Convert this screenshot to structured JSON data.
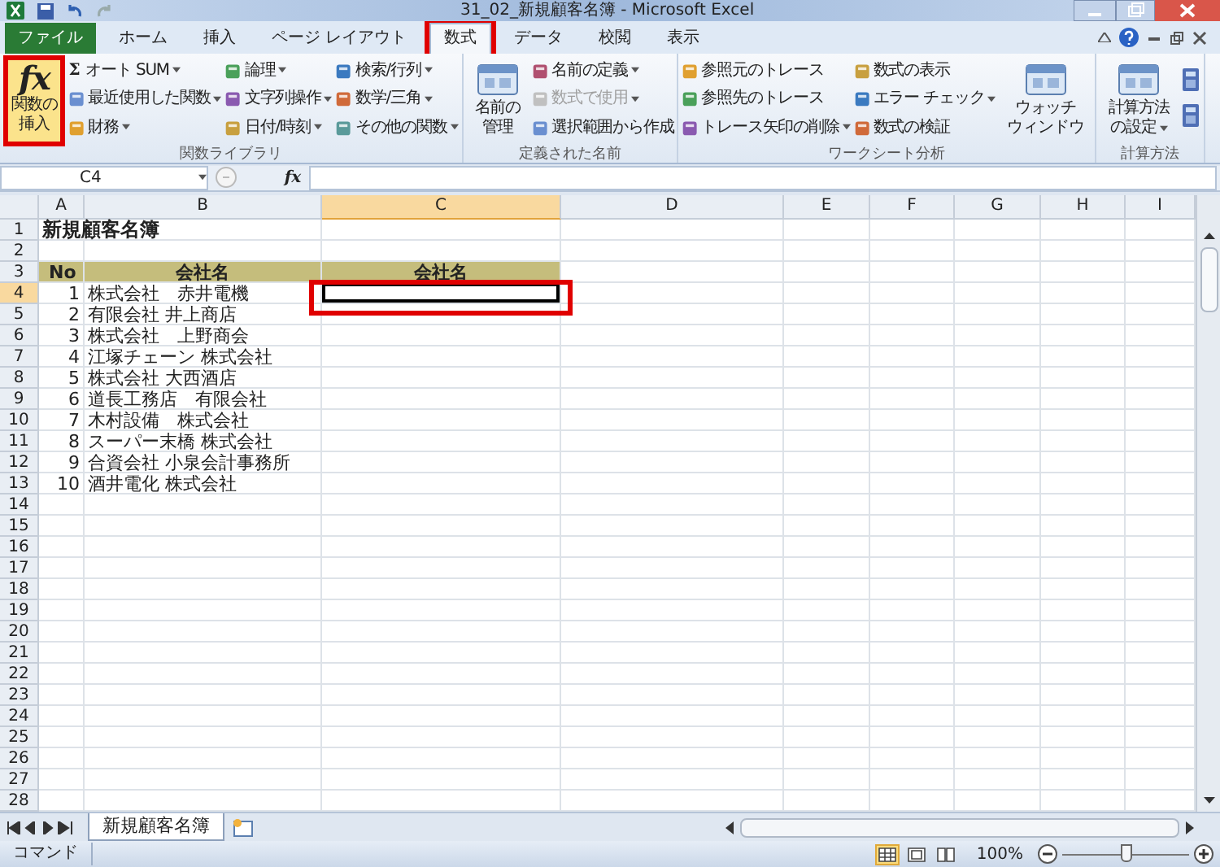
{
  "window": {
    "title": "31_02_新規顧客名簿 - Microsoft Excel"
  },
  "tabs": [
    {
      "label": "ファイル",
      "kind": "file",
      "selected": false,
      "highlighted": false
    },
    {
      "label": "ホーム",
      "kind": "tab",
      "selected": false,
      "highlighted": false
    },
    {
      "label": "挿入",
      "kind": "tab",
      "selected": false,
      "highlighted": false
    },
    {
      "label": "ページ レイアウト",
      "kind": "tab",
      "selected": false,
      "highlighted": false
    },
    {
      "label": "数式",
      "kind": "tab",
      "selected": true,
      "highlighted": true
    },
    {
      "label": "データ",
      "kind": "tab",
      "selected": false,
      "highlighted": false
    },
    {
      "label": "校閲",
      "kind": "tab",
      "selected": false,
      "highlighted": false
    },
    {
      "label": "表示",
      "kind": "tab",
      "selected": false,
      "highlighted": false
    }
  ],
  "ribbon": {
    "groups": [
      {
        "label": "関数ライブラリ",
        "blocks": [
          {
            "kind": "big",
            "symbol": "fx",
            "lines": [
              "関数の",
              "挿入"
            ],
            "caret": false,
            "highlighted": true
          },
          {
            "kind": "column",
            "items": [
              {
                "label": "オート SUM",
                "symbol": "Σ",
                "caret": true,
                "disabled": false
              },
              {
                "label": "最近使用した関数",
                "caret": true,
                "disabled": false
              },
              {
                "label": "財務",
                "caret": true,
                "disabled": false
              }
            ]
          },
          {
            "kind": "column",
            "items": [
              {
                "label": "論理",
                "caret": true,
                "disabled": false
              },
              {
                "label": "文字列操作",
                "caret": true,
                "disabled": false
              },
              {
                "label": "日付/時刻",
                "caret": true,
                "disabled": false
              }
            ]
          },
          {
            "kind": "column",
            "items": [
              {
                "label": "検索/行列",
                "caret": true,
                "disabled": false
              },
              {
                "label": "数学/三角",
                "caret": true,
                "disabled": false
              },
              {
                "label": "その他の関数",
                "caret": true,
                "disabled": false
              }
            ]
          }
        ]
      },
      {
        "label": "定義された名前",
        "blocks": [
          {
            "kind": "big",
            "lines": [
              "名前の",
              "管理"
            ],
            "caret": false,
            "highlighted": false
          },
          {
            "kind": "column",
            "items": [
              {
                "label": "名前の定義",
                "caret": true,
                "disabled": false
              },
              {
                "label": "数式で使用",
                "caret": true,
                "disabled": true
              },
              {
                "label": "選択範囲から作成",
                "caret": false,
                "disabled": false
              }
            ]
          }
        ]
      },
      {
        "label": "ワークシート分析",
        "blocks": [
          {
            "kind": "column",
            "items": [
              {
                "label": "参照元のトレース",
                "caret": false,
                "disabled": false
              },
              {
                "label": "参照先のトレース",
                "caret": false,
                "disabled": false
              },
              {
                "label": "トレース矢印の削除",
                "caret": true,
                "disabled": false
              }
            ]
          },
          {
            "kind": "column",
            "items": [
              {
                "label": "数式の表示",
                "caret": false,
                "disabled": false
              },
              {
                "label": "エラー チェック",
                "caret": true,
                "disabled": false
              },
              {
                "label": "数式の検証",
                "caret": false,
                "disabled": false
              }
            ]
          },
          {
            "kind": "big",
            "lines": [
              "ウォッチ",
              "ウィンドウ"
            ],
            "caret": false,
            "highlighted": false
          }
        ]
      },
      {
        "label": "計算方法",
        "blocks": [
          {
            "kind": "big",
            "lines": [
              "計算方法",
              "の設定"
            ],
            "caret": true,
            "highlighted": false
          },
          {
            "kind": "icons"
          }
        ]
      }
    ]
  },
  "formula_bar": {
    "name_box": "C4",
    "function_symbol": "fx"
  },
  "columns": [
    {
      "label": "A",
      "selected": false
    },
    {
      "label": "B",
      "selected": false
    },
    {
      "label": "C",
      "selected": true
    },
    {
      "label": "D",
      "selected": false
    },
    {
      "label": "E",
      "selected": false
    },
    {
      "label": "F",
      "selected": false
    },
    {
      "label": "G",
      "selected": false
    },
    {
      "label": "H",
      "selected": false
    },
    {
      "label": "I",
      "selected": false
    }
  ],
  "active_cell": {
    "highlighted": true
  },
  "rows": [
    {
      "number": "1",
      "selected": false,
      "kind": "title",
      "a": "新規顧客名簿"
    },
    {
      "number": "2",
      "selected": false,
      "kind": "plain"
    },
    {
      "number": "3",
      "selected": false,
      "kind": "header",
      "a": "No",
      "b": "会社名",
      "c": "会社名"
    },
    {
      "number": "4",
      "selected": true,
      "kind": "plain",
      "a": "1",
      "b": "株式会社　赤井電機"
    },
    {
      "number": "5",
      "selected": false,
      "kind": "plain",
      "a": "2",
      "b": "有限会社 井上商店"
    },
    {
      "number": "6",
      "selected": false,
      "kind": "plain",
      "a": "3",
      "b": "株式会社　上野商会"
    },
    {
      "number": "7",
      "selected": false,
      "kind": "plain",
      "a": "4",
      "b": "江塚チェーン 株式会社"
    },
    {
      "number": "8",
      "selected": false,
      "kind": "plain",
      "a": "5",
      "b": "株式会社 大西酒店"
    },
    {
      "number": "9",
      "selected": false,
      "kind": "plain",
      "a": "6",
      "b": "道長工務店　有限会社"
    },
    {
      "number": "10",
      "selected": false,
      "kind": "plain",
      "a": "7",
      "b": "木村設備　株式会社"
    },
    {
      "number": "11",
      "selected": false,
      "kind": "plain",
      "a": "8",
      "b": "スーパー末橋 株式会社"
    },
    {
      "number": "12",
      "selected": false,
      "kind": "plain",
      "a": "9",
      "b": "合資会社 小泉会計事務所"
    },
    {
      "number": "13",
      "selected": false,
      "kind": "plain",
      "a": "10",
      "b": "酒井電化 株式会社"
    },
    {
      "number": "14",
      "selected": false,
      "kind": "plain"
    },
    {
      "number": "15",
      "selected": false,
      "kind": "plain"
    },
    {
      "number": "16",
      "selected": false,
      "kind": "plain"
    },
    {
      "number": "17",
      "selected": false,
      "kind": "plain"
    },
    {
      "number": "18",
      "selected": false,
      "kind": "plain"
    },
    {
      "number": "19",
      "selected": false,
      "kind": "plain"
    },
    {
      "number": "20",
      "selected": false,
      "kind": "plain"
    },
    {
      "number": "21",
      "selected": false,
      "kind": "plain"
    },
    {
      "number": "22",
      "selected": false,
      "kind": "plain"
    },
    {
      "number": "23",
      "selected": false,
      "kind": "plain"
    },
    {
      "number": "24",
      "selected": false,
      "kind": "plain"
    },
    {
      "number": "25",
      "selected": false,
      "kind": "plain"
    },
    {
      "number": "26",
      "selected": false,
      "kind": "plain"
    },
    {
      "number": "27",
      "selected": false,
      "kind": "plain"
    },
    {
      "number": "28",
      "selected": false,
      "kind": "plain"
    }
  ],
  "sheet_tabs": [
    {
      "label": "新規顧客名簿",
      "selected": true
    }
  ],
  "status_bar": {
    "mode": "コマンド",
    "views": [
      {
        "kind": "normal",
        "selected": true
      },
      {
        "kind": "layout",
        "selected": false
      },
      {
        "kind": "pagebreak",
        "selected": false
      }
    ],
    "zoom": "100%",
    "zoom_slider": {
      "level": 0.5
    }
  }
}
